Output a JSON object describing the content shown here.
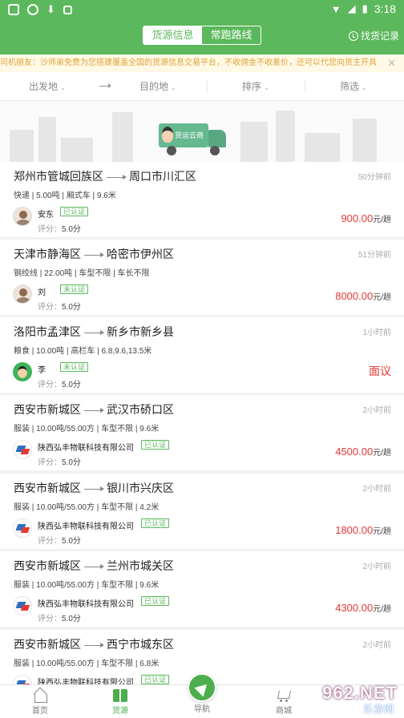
{
  "status_bar": {
    "time": "3:18"
  },
  "header": {
    "seg_cargo": "货源信息",
    "seg_routes": "常跑路线",
    "find_record": "找货记录"
  },
  "notice": {
    "text": "司机朋友：沙师弟免费为您搭建覆盖全国的货源信息交易平台，不收佣金不收差价，还可以代您向货主开具",
    "close": "✕"
  },
  "filters": {
    "origin": "出发地",
    "destination": "目的地",
    "sort": "排序",
    "filter": "筛选"
  },
  "banner": {
    "truck_label": "货运云商"
  },
  "cards": [
    {
      "from": "郑州市管城回族区",
      "to": "周口市川汇区",
      "time": "50分钟前",
      "spec": "快递 | 5.00吨 | 厢式车 | 9.6米",
      "name": "安东",
      "tag": "已认证",
      "score_label": "评分：",
      "score": "5.0分",
      "price": "900.00",
      "unit": "元/趟"
    },
    {
      "from": "天津市静海区",
      "to": "哈密市伊州区",
      "time": "51分钟前",
      "spec": "钢绞线 | 22.00吨 | 车型不限 | 车长不限",
      "name": "刘",
      "tag": "未认证",
      "score_label": "评分：",
      "score": "5.0分",
      "price": "8000.00",
      "unit": "元/趟"
    },
    {
      "from": "洛阳市孟津区",
      "to": "新乡市新乡县",
      "time": "1小时前",
      "spec": "粮食 | 10.00吨 | 高栏车 | 6.8,9.6,13.5米",
      "name": "李",
      "tag": "未认证",
      "score_label": "评分：",
      "score": "5.0分",
      "price": "面议",
      "unit": ""
    },
    {
      "from": "西安市新城区",
      "to": "武汉市硚口区",
      "time": "2小时前",
      "spec": "服装 | 10.00吨/55.00方 | 车型不限 | 9.6米",
      "name": "陕西弘丰物联科技有限公司",
      "tag": "已认证",
      "score_label": "评分：",
      "score": "5.0分",
      "price": "4500.00",
      "unit": "元/趟"
    },
    {
      "from": "西安市新城区",
      "to": "银川市兴庆区",
      "time": "2小时前",
      "spec": "服装 | 10.00吨/55.00方 | 车型不限 | 4.2米",
      "name": "陕西弘丰物联科技有限公司",
      "tag": "已认证",
      "score_label": "评分：",
      "score": "5.0分",
      "price": "1800.00",
      "unit": "元/趟"
    },
    {
      "from": "西安市新城区",
      "to": "兰州市城关区",
      "time": "2小时前",
      "spec": "服装 | 10.00吨/55.00方 | 车型不限 | 9.6米",
      "name": "陕西弘丰物联科技有限公司",
      "tag": "已认证",
      "score_label": "评分：",
      "score": "5.0分",
      "price": "4300.00",
      "unit": "元/趟"
    },
    {
      "from": "西安市新城区",
      "to": "西宁市城东区",
      "time": "2小时前",
      "spec": "服装 | 10.00吨/55.00方 | 车型不限 | 6.8米",
      "name": "陕西弘丰物联科技有限公司",
      "tag": "已认证",
      "score_label": "",
      "score": "",
      "price": "",
      "unit": ""
    }
  ],
  "tabs": {
    "home": "首页",
    "cargo": "货源",
    "nav": "导航",
    "mall": "商城"
  },
  "watermark": {
    "main": "962.NET",
    "sub": "乐游网"
  },
  "colors": {
    "primary": "#5cb85c",
    "price": "#e53935",
    "notice": "#e0a33b"
  }
}
